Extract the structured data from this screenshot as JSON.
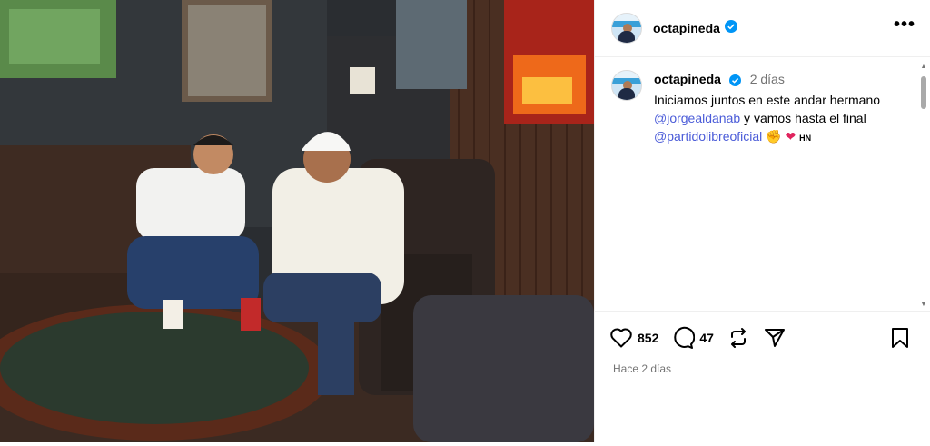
{
  "post": {
    "username": "octapineda",
    "more_label": "•••",
    "caption": {
      "username": "octapineda",
      "time": "2 días",
      "text_line1": "Iniciamos juntos en este andar hermano",
      "mention1": "@jorgealdanab",
      "text_line2": " y vamos hasta el final",
      "mention2": "@partidolibreoficial",
      "emojis": "✊ ❤",
      "flag_text": "HN"
    },
    "likes": "852",
    "comments": "47",
    "date_label": "Hace 2 días"
  },
  "icons": {
    "verified": "verified-badge-icon",
    "like": "heart-icon",
    "comment": "comment-icon",
    "repost": "repost-icon",
    "share": "share-icon",
    "save": "bookmark-icon"
  },
  "colors": {
    "mention": "#4a5bd8",
    "verified": "#0095f6",
    "muted": "#737373"
  }
}
